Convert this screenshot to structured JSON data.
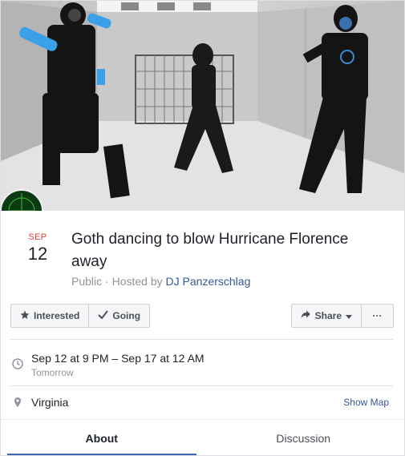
{
  "event": {
    "month": "SEP",
    "day": "12",
    "title": "Goth dancing to blow Hurricane Florence away",
    "privacy": "Public",
    "separator": " · ",
    "hosted_by_label": "Hosted by ",
    "host": "DJ Panzerschlag"
  },
  "actions": {
    "interested": "Interested",
    "going": "Going",
    "share": "Share",
    "more": "···"
  },
  "details": {
    "time_main": "Sep 12 at 9 PM – Sep 17 at 12 AM",
    "time_sub": "Tomorrow",
    "location": "Virginia",
    "show_map": "Show Map"
  },
  "tabs": [
    {
      "label": "About",
      "active": true
    },
    {
      "label": "Discussion",
      "active": false
    }
  ],
  "colors": {
    "accent": "#4267b2",
    "link": "#365899",
    "month": "#e0403a",
    "muted": "#90949c"
  },
  "icons": [
    "star-icon",
    "check-icon",
    "share-arrow-icon",
    "caret-down-icon",
    "clock-icon",
    "location-pin-icon",
    "radar-badge-icon"
  ]
}
